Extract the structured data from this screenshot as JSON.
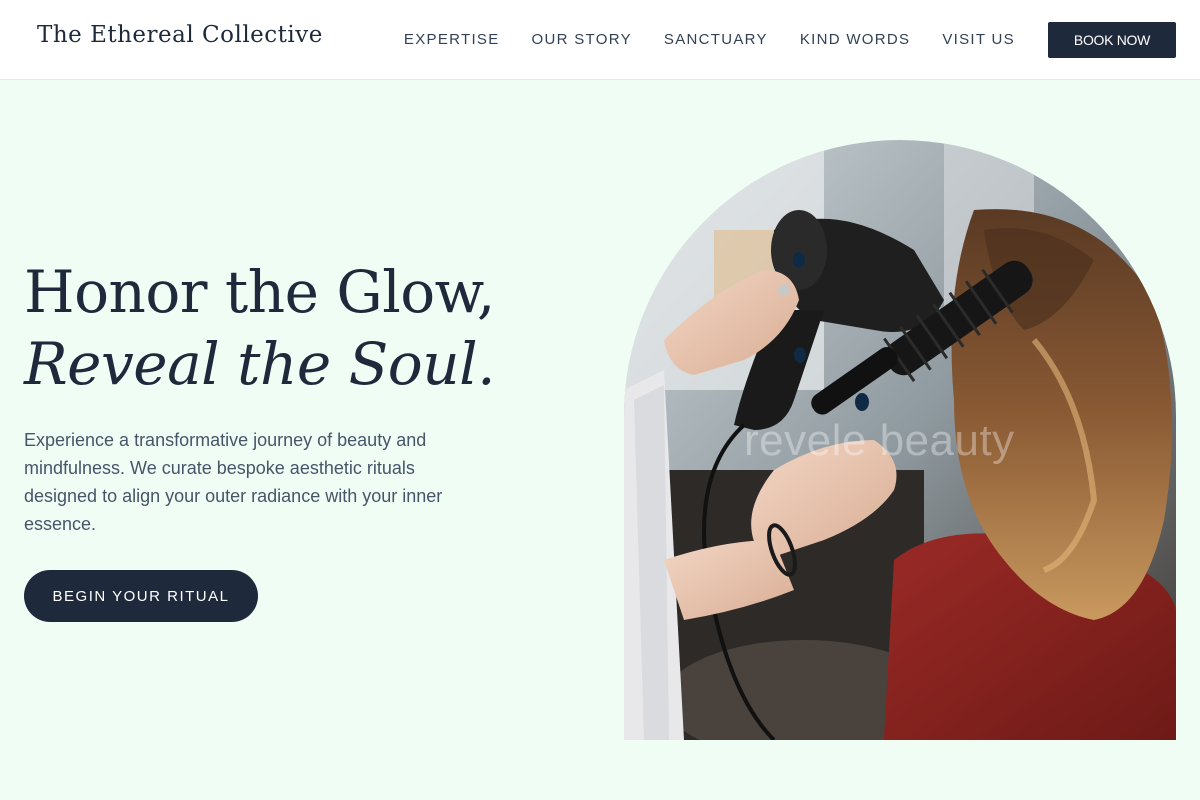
{
  "brand": {
    "name": "The Ethereal Collective"
  },
  "nav": {
    "items": [
      {
        "label": "EXPERTISE"
      },
      {
        "label": "OUR STORY"
      },
      {
        "label": "SANCTUARY"
      },
      {
        "label": "KIND WORDS"
      },
      {
        "label": "VISIT US"
      }
    ],
    "cta_label": "BOOK NOW"
  },
  "hero": {
    "headline_line1": "Honor the Glow,",
    "headline_line2": "Reveal the Soul.",
    "description": "Experience a transformative journey of beauty and mindfulness. We curate bespoke aesthetic rituals designed to align your outer radiance with your inner essence.",
    "cta_label": "BEGIN YOUR RITUAL",
    "image": {
      "subject": "stylist blow-drying client's hair with a round brush",
      "watermark": "revele beauty"
    }
  },
  "colors": {
    "background": "#f0fdf4",
    "header_bg": "#ffffff",
    "primary": "#1e293b",
    "body_text": "#475569"
  }
}
